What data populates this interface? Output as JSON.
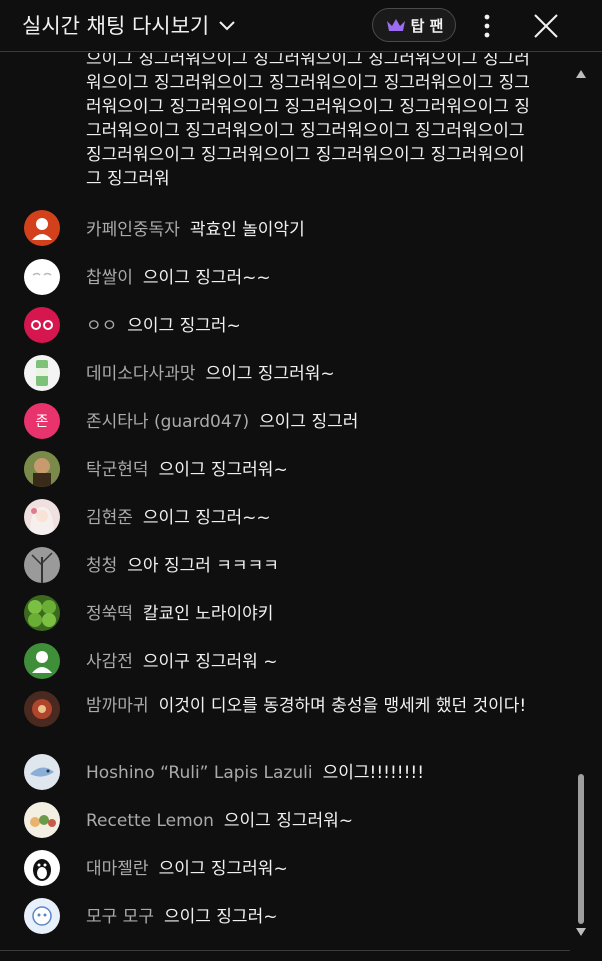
{
  "header": {
    "title": "실시간 채팅 다시보기",
    "top_fan_label": "탑 팬"
  },
  "long_message": "으이그 징그러워으이그 징그러워으이그 징그러워으이그 징그러워으이그 징그러워으이그 징그러워으이그 징그러워으이그 징그러워으이그 징그러워으이그 징그러워으이그 징그러워으이그 징그러워으이그 징그러워으이그 징그러워으이그 징그러워으이그 징그러워으이그 징그러워으이그 징그러워으이그 징그러워으이그 징그러워",
  "messages": [
    {
      "author": "카페인중독자",
      "text": "곽효인 놀이악기",
      "avatar": "person-red"
    },
    {
      "author": "찹쌀이",
      "text": "으이그 징그러~~",
      "avatar": "white-face"
    },
    {
      "author": "ㅇㅇ",
      "text": "으이그 징그러~",
      "avatar": "pink-eyes"
    },
    {
      "author": "데미소다사과맛",
      "text": "으이그 징그러워~",
      "avatar": "soda-can"
    },
    {
      "author": "존시타나 (guard047)",
      "text": "으이그 징그러",
      "avatar": "letter-jon"
    },
    {
      "author": "탁군현덕",
      "text": "으이그 징그러워~",
      "avatar": "photo-man"
    },
    {
      "author": "김현준",
      "text": "으이그 징그러~~",
      "avatar": "anime-girl"
    },
    {
      "author": "청청",
      "text": "으아 징그러 ㅋㅋㅋㅋ",
      "avatar": "tree"
    },
    {
      "author": "정쑥떡",
      "text": "칼쿄인 노라이야키",
      "avatar": "green-balls"
    },
    {
      "author": "사감전",
      "text": "으이구 징그러워 ~",
      "avatar": "person-green"
    },
    {
      "author": "밤까마귀",
      "text": "이것이 디오를 동경하며 충성을 맹세케 했던 것이다!",
      "avatar": "crow-art"
    },
    {
      "author": "Hoshino “Ruli” Lapis Lazuli",
      "text": "으이그!!!!!!!!",
      "avatar": "blue-fish"
    },
    {
      "author": "Recette Lemon",
      "text": "으이그 징그러워~",
      "avatar": "cartoon-group"
    },
    {
      "author": "대마젤란",
      "text": "으이그 징그러워~",
      "avatar": "penguin"
    },
    {
      "author": "모구 모구",
      "text": "으이그 징그러~",
      "avatar": "chibi"
    }
  ],
  "colors": {
    "background": "#0f0f0f",
    "author": "#aaaaaa",
    "text": "#f1f1f1",
    "crown": "#9b6cf0"
  }
}
